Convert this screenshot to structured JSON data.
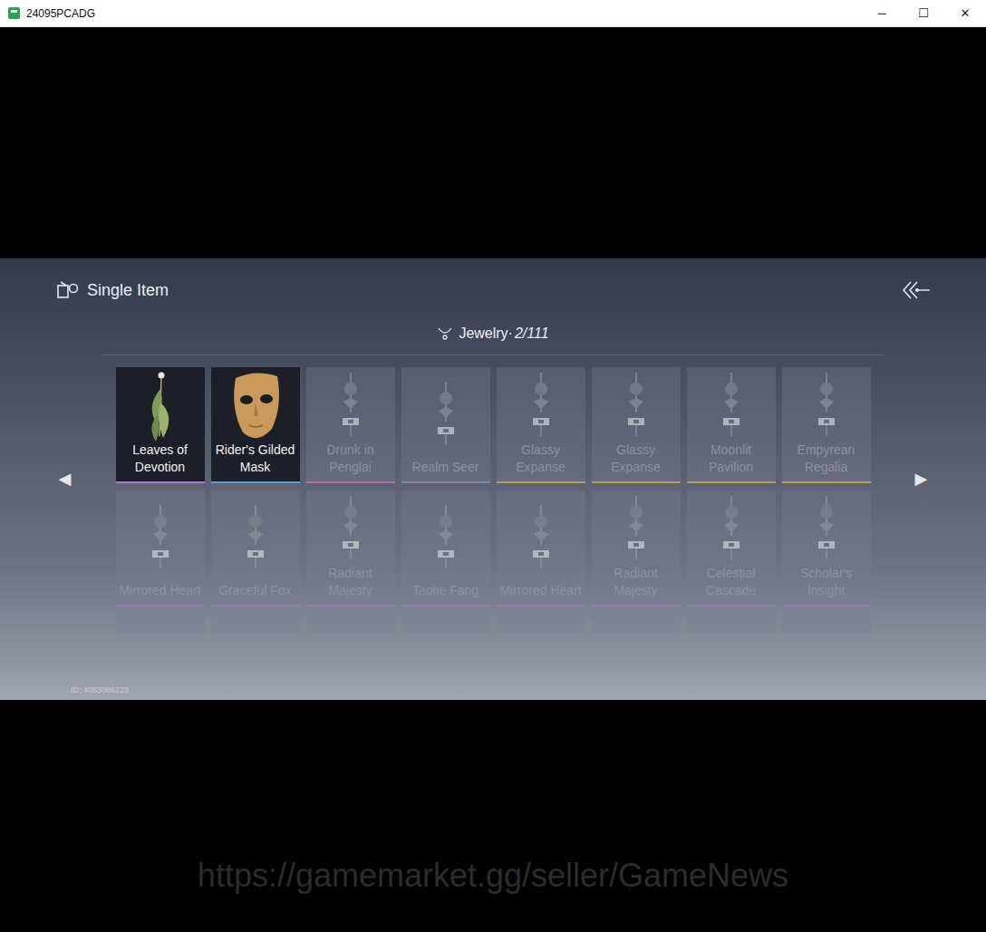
{
  "window": {
    "title": "24095PCADG",
    "controls": [
      "─",
      "☐",
      "✕"
    ]
  },
  "header": {
    "title": "Single Item"
  },
  "category": {
    "label": "Jewelry·",
    "count": "2/111"
  },
  "nav": {
    "prev": "◀",
    "next": "▶"
  },
  "items": [
    {
      "name": "Leaves of Devotion",
      "owned": true,
      "kind": "leaf",
      "color": "#a57ac8"
    },
    {
      "name": "Rider's Gilded Mask",
      "owned": true,
      "kind": "mask",
      "color": "#5c9ad6"
    },
    {
      "name": "Drunk in Penglai",
      "owned": false,
      "kind": "pendant",
      "color": "#b46ea6"
    },
    {
      "name": "Realm Seer",
      "owned": false,
      "kind": "pendant",
      "color": "#8c82a8"
    },
    {
      "name": "Glassy Expanse",
      "owned": false,
      "kind": "pendant",
      "color": "#b99b5c"
    },
    {
      "name": "Glassy Expanse",
      "owned": false,
      "kind": "pendant",
      "color": "#b99b5c"
    },
    {
      "name": "Moonlit Pavilion",
      "owned": false,
      "kind": "pendant",
      "color": "#b99b5c"
    },
    {
      "name": "Empyrean Regalia",
      "owned": false,
      "kind": "pendant",
      "color": "#b99b5c"
    },
    {
      "name": "Mirrored Heart",
      "owned": false,
      "kind": "pendant",
      "color": "#8c82a8"
    },
    {
      "name": "Graceful Fox",
      "owned": false,
      "kind": "pendant",
      "color": "#8c82a8"
    },
    {
      "name": "Radiant Majesty",
      "owned": false,
      "kind": "pendant",
      "color": "#8c82a8"
    },
    {
      "name": "Taotie Fang",
      "owned": false,
      "kind": "pendant",
      "color": "#8c82a8"
    },
    {
      "name": "Mirrored Heart",
      "owned": false,
      "kind": "pendant",
      "color": "#8c82a8"
    },
    {
      "name": "Radiant Majesty",
      "owned": false,
      "kind": "pendant",
      "color": "#8c82a8"
    },
    {
      "name": "Celestial Cascade",
      "owned": false,
      "kind": "pendant",
      "color": "#8c82a8"
    },
    {
      "name": "Scholar's Insight",
      "owned": false,
      "kind": "pendant",
      "color": "#8c82a8"
    }
  ],
  "cut_row_cards": [
    {
      "owned": false
    },
    {
      "owned": false
    },
    {
      "owned": false
    },
    {
      "owned": false
    },
    {
      "owned": false
    },
    {
      "owned": false
    },
    {
      "owned": false
    },
    {
      "owned": false
    }
  ],
  "account_id": "ID: 4083086223",
  "watermark": "https://gamemarket.gg/seller/GameNews"
}
